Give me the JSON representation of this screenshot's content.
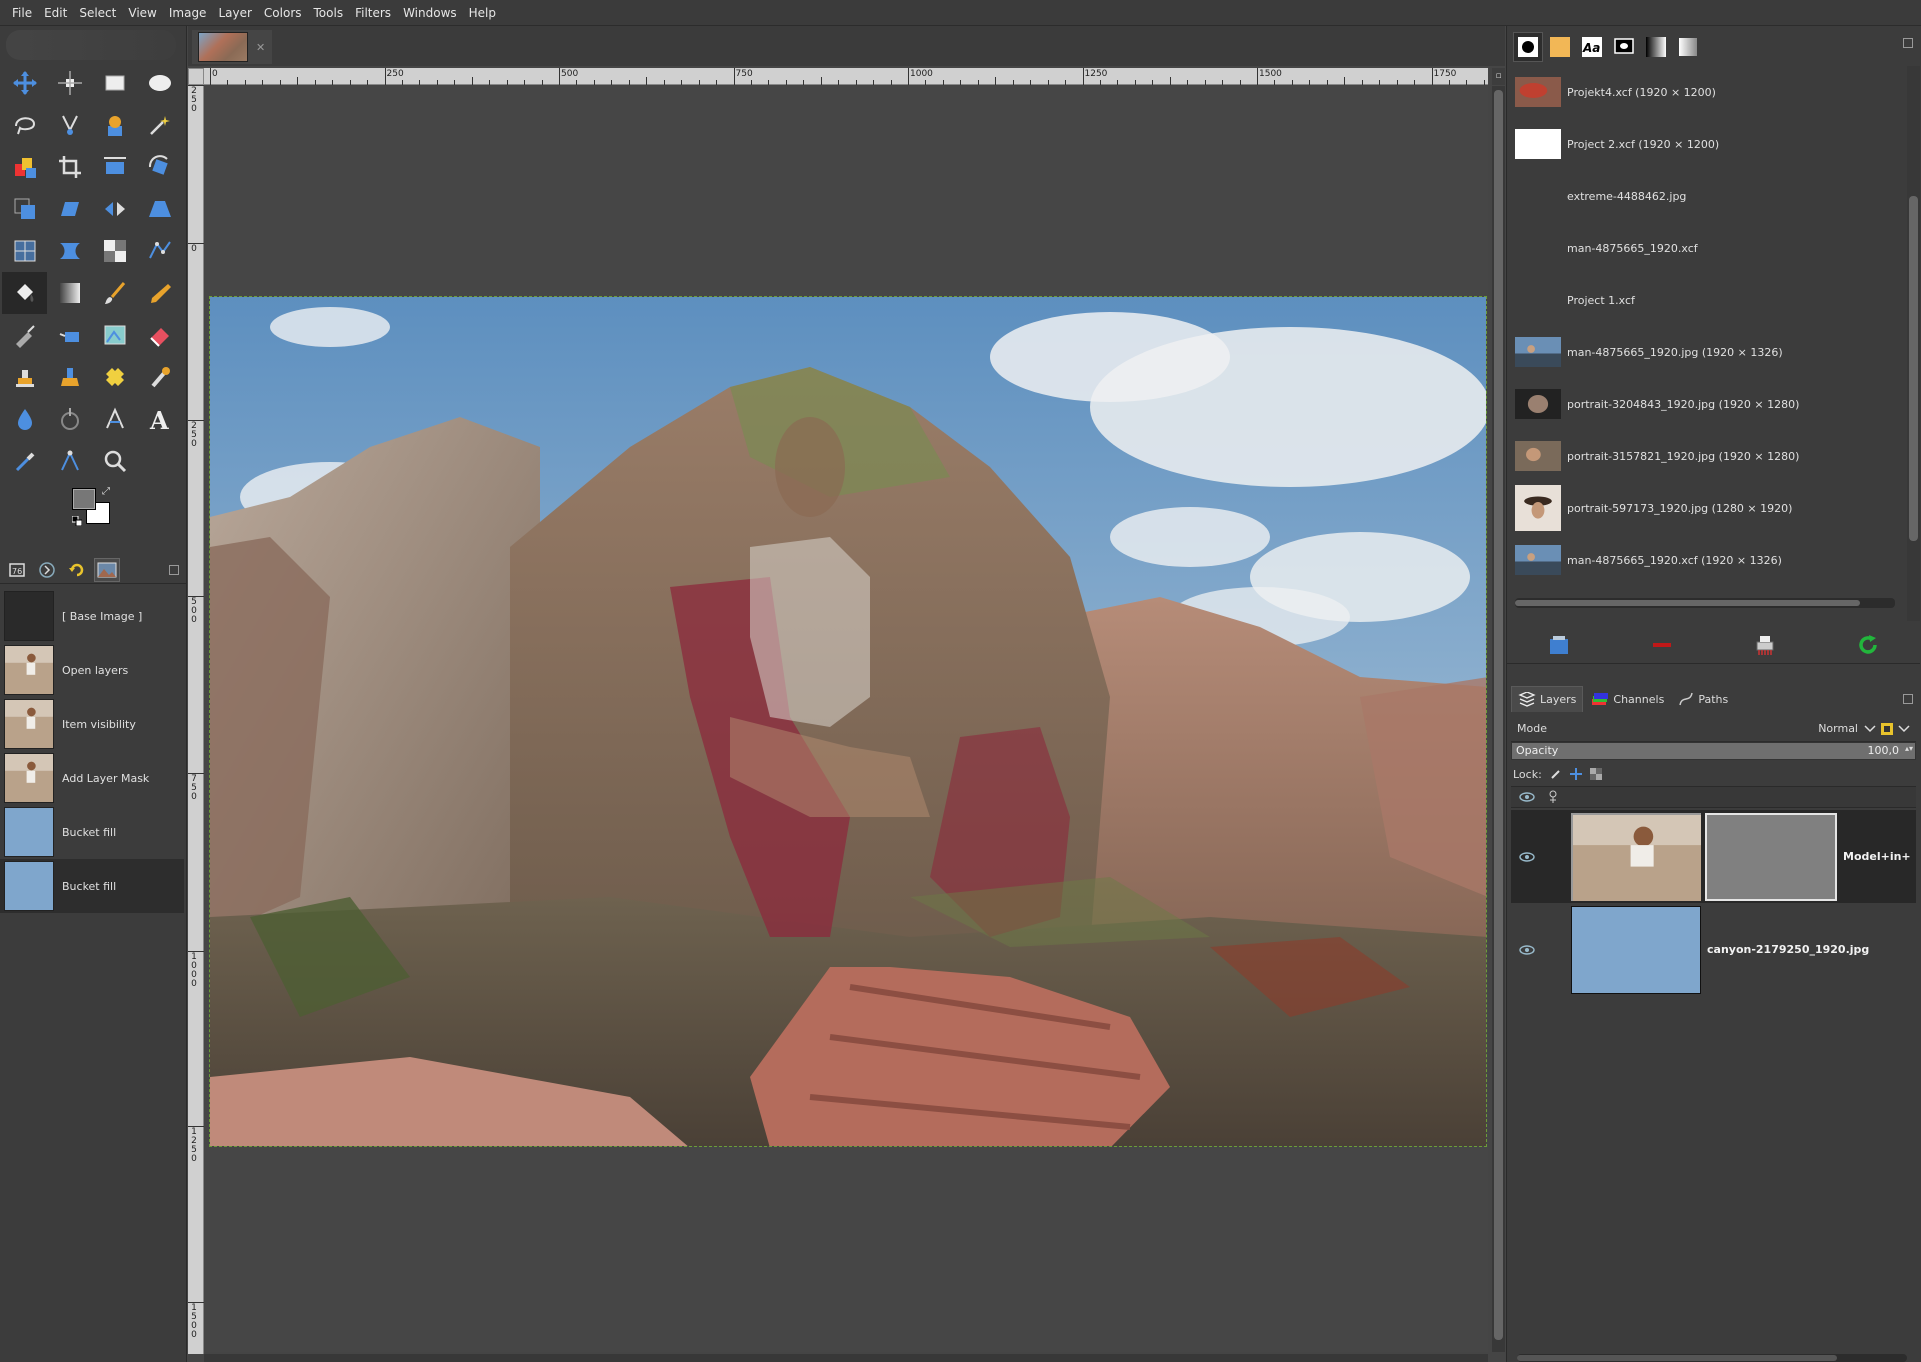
{
  "menubar": {
    "items": [
      "File",
      "Edit",
      "Select",
      "View",
      "Image",
      "Layer",
      "Colors",
      "Tools",
      "Filters",
      "Windows",
      "Help"
    ]
  },
  "toolbox": {
    "tools": [
      "move-tool-icon",
      "align-tool-icon",
      "rect-select-icon",
      "ellipse-select-icon",
      "free-select-icon",
      "scissors-select-icon",
      "foreground-select-icon",
      "fuzzy-select-icon",
      "color-select-icon",
      "crop-tool-icon",
      "unified-transform-icon",
      "rotate-tool-icon",
      "scale-tool-icon",
      "shear-tool-icon",
      "flip-tool-icon",
      "perspective-tool-icon",
      "cage-transform-icon",
      "warp-transform-icon",
      "handle-transform-icon",
      "path-tool-icon",
      "bucket-fill-icon",
      "gradient-tool-icon",
      "paintbrush-icon",
      "pencil-icon",
      "ink-tool-icon",
      "airbrush-icon",
      "mypaint-brush-icon",
      "eraser-icon",
      "clone-tool-icon",
      "perspective-clone-icon",
      "heal-tool-icon",
      "smudge-tool-icon",
      "dodge-burn-icon",
      "blur-sharpen-icon",
      "measure-tool-icon",
      "text-tool-icon",
      "color-picker-icon",
      "paths-measure-icon",
      "zoom-tool-icon",
      "empty-slot"
    ],
    "active_tool_index": 20,
    "fg_color": "#777777",
    "bg_color": "#ffffff"
  },
  "undo_history": {
    "items": [
      {
        "label": "[ Base Image ]",
        "thumb": "empty"
      },
      {
        "label": "Open layers",
        "thumb": "model"
      },
      {
        "label": "Item visibility",
        "thumb": "model"
      },
      {
        "label": "Add Layer Mask",
        "thumb": "model"
      },
      {
        "label": "Bucket fill",
        "thumb": "canyon"
      },
      {
        "label": "Bucket fill",
        "thumb": "canyon"
      }
    ],
    "active_index": 5
  },
  "ruler": {
    "h_labels": [
      "0",
      "250",
      "500",
      "750",
      "1000",
      "1250",
      "1500",
      "1750"
    ],
    "v_labels": [
      "250",
      "0",
      "250",
      "500",
      "750",
      "1000",
      "1250",
      "1500"
    ]
  },
  "images_panel": {
    "items": [
      {
        "label": "Projekt4.xcf (1920 × 1200)",
        "thumb": "landscape-red"
      },
      {
        "label": "Project 2.xcf (1920 × 1200)",
        "thumb": "black-shape"
      },
      {
        "label": "extreme-4488462.jpg",
        "thumb": "blank"
      },
      {
        "label": "man-4875665_1920.xcf",
        "thumb": "blank"
      },
      {
        "label": "Project 1.xcf",
        "thumb": "blank"
      },
      {
        "label": "man-4875665_1920.jpg (1920 × 1326)",
        "thumb": "man"
      },
      {
        "label": "portrait-3204843_1920.jpg (1920 × 1280)",
        "thumb": "portrait-dark"
      },
      {
        "label": "portrait-3157821_1920.jpg (1920 × 1280)",
        "thumb": "portrait-warm"
      },
      {
        "label": "portrait-597173_1920.jpg (1280 × 1920)",
        "thumb": "portrait-hat"
      },
      {
        "label": "man-4875665_1920.xcf (1920 × 1326)",
        "thumb": "man"
      }
    ]
  },
  "layers_panel": {
    "tabs": [
      "Layers",
      "Channels",
      "Paths"
    ],
    "mode_label": "Mode",
    "mode_value": "Normal",
    "opacity_label": "Opacity",
    "opacity_value": "100,0",
    "opacity_fraction": 1.0,
    "lock_label": "Lock:",
    "layers": [
      {
        "name": "Model+in+",
        "thumb": "model",
        "has_mask": true,
        "visible": true
      },
      {
        "name": "canyon-2179250_1920.jpg",
        "thumb": "canyon",
        "has_mask": false,
        "visible": true
      }
    ]
  },
  "colors": {
    "selection_border": "#6b9d38",
    "panel_bg": "#3c3c3c",
    "canvas_bg": "#464646"
  }
}
